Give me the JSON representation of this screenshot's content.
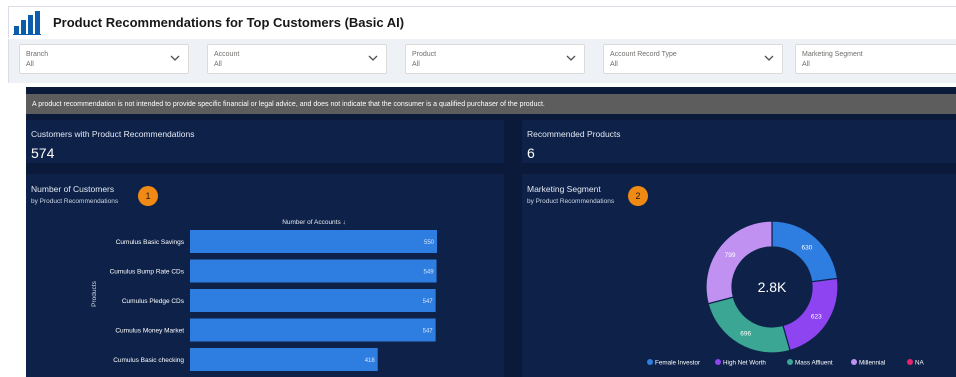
{
  "header": {
    "title": "Product Recommendations for Top Customers (Basic AI)",
    "icon": "bar-chart-icon",
    "accent": "#0b5cab"
  },
  "filters": [
    {
      "label": "Branch",
      "value": "All"
    },
    {
      "label": "Account",
      "value": "All"
    },
    {
      "label": "Product",
      "value": "All"
    },
    {
      "label": "Account Record Type",
      "value": "All"
    },
    {
      "label": "Marketing Segment",
      "value": "All"
    }
  ],
  "notice": "A product recommendation is not intended to provide specific financial or legal advice, and does not indicate that the consumer is a qualified purchaser of the product.",
  "kpis": {
    "customers": {
      "title": "Customers with Product  Recommendations",
      "value": "574"
    },
    "products": {
      "title": "Recommended Products",
      "value": "6"
    }
  },
  "customers_chart": {
    "title": "Number of Customers",
    "subtitle": "by Product Recommendations",
    "badge": "1"
  },
  "segment_chart": {
    "title": "Marketing Segment",
    "subtitle": "by Product Recommendations",
    "badge": "2",
    "center_label": "2.8K"
  },
  "colors": {
    "background": "#0b1a3b",
    "card": "#0e2249",
    "bar": "#2e7de0",
    "badge": "#f08a14"
  },
  "chart_data": [
    {
      "type": "bar",
      "orientation": "horizontal",
      "xlabel": "Number of Accounts ↓",
      "ylabel": "Products",
      "categories": [
        "Cumulus Basic Savings",
        "Cumulus Bump Rate CDs",
        "Cumulus Pledge CDs",
        "Cumulus Money Market",
        "Cumulus Basic checking"
      ],
      "values": [
        550,
        549,
        547,
        547,
        418
      ],
      "grid": false
    },
    {
      "type": "pie",
      "donut": true,
      "center_label": "2.8K",
      "categories": [
        "Female Investor",
        "High Net Worth",
        "Mass Affluent",
        "Millennial",
        "NA"
      ],
      "values": [
        630,
        623,
        696,
        799,
        0
      ],
      "colors": [
        "#2e7de0",
        "#8e44f0",
        "#3aa693",
        "#c191f2",
        "#e6246e"
      ],
      "legend": "bottom"
    }
  ]
}
